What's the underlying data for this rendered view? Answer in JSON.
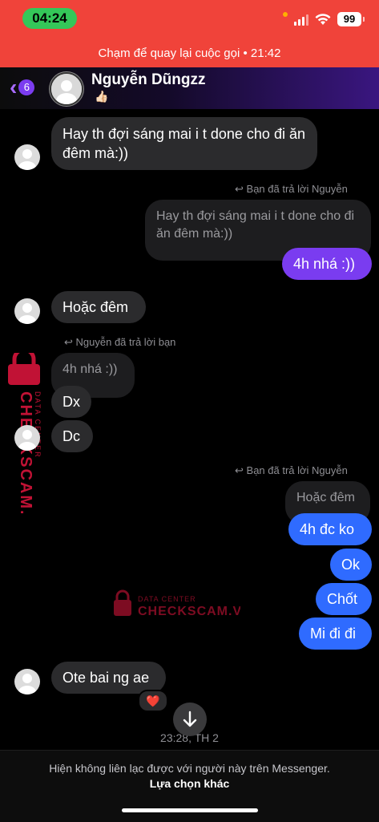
{
  "status_bar": {
    "time": "04:24",
    "battery": "99"
  },
  "call_banner": {
    "text": "Chạm để quay lại cuộc gọi • 21:42"
  },
  "header": {
    "back_count": "6",
    "name": "Nguyễn Dũngzz",
    "status_emoji": "👍🏻"
  },
  "messages": {
    "m1": "Hay th đợi sáng mai i t done cho đi ăn đêm mà:))",
    "reply_label_1": "Bạn đã trả lời Nguyễn",
    "quote_1": "Hay th đợi sáng mai i t done cho đi ăn đêm mà:))",
    "m2": "4h nhá :))",
    "m3": "Hoặc đêm",
    "reply_label_2": "Nguyễn đã trả lời bạn",
    "quote_2": "4h nhá :))",
    "m4": "Dx",
    "m5": "Dc",
    "reply_label_3": "Bạn đã trả lời Nguyễn",
    "quote_3": "Hoặc đêm",
    "m6": "4h đc ko",
    "m7": "Ok",
    "m8": "Chốt",
    "m9": "Mi đi đi",
    "m10": "Ote bai ng ae",
    "reaction": "❤️"
  },
  "timestamp": "23:28, TH 2",
  "footer": {
    "message": "Hiện không liên lạc được với người này trên Messenger.",
    "link": "Lựa chọn khác"
  },
  "watermark": {
    "brand": "CHECKSCAM.VN",
    "subtitle": "DATA CENTER"
  },
  "colors": {
    "call_banner": "#f0433a",
    "accent_purple": "#7a3cf0",
    "accent_blue": "#2f6bff",
    "incoming": "#2b2b2d",
    "watermark": "#e3163f"
  }
}
